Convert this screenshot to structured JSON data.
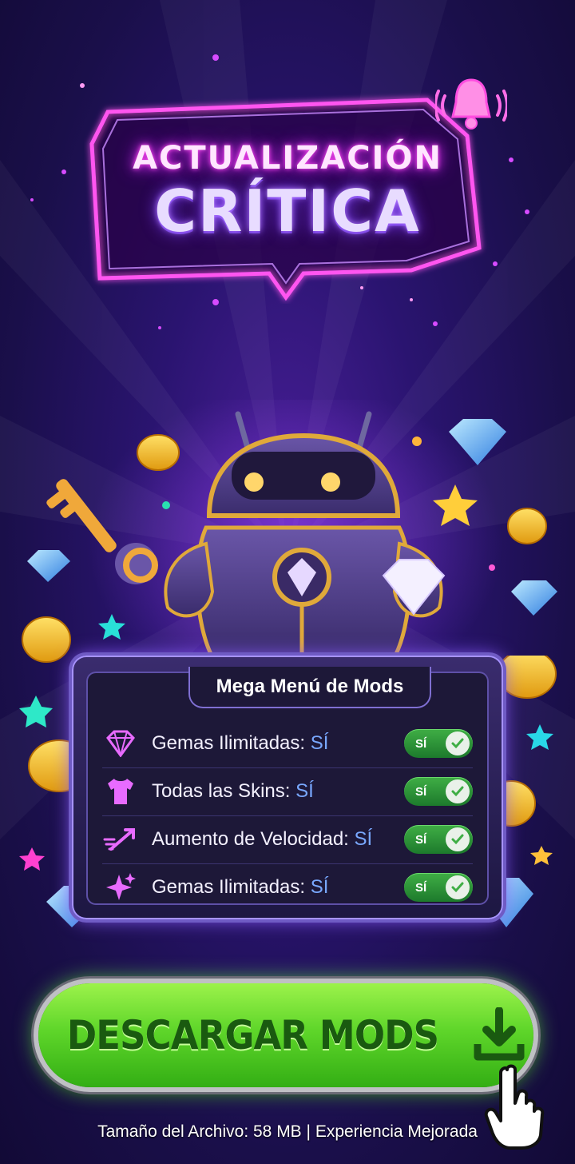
{
  "banner": {
    "line1": "ACTUALIZACIÓN",
    "line2": "CRÍTICA"
  },
  "panel": {
    "title": "Mega Menú de Mods",
    "rows": [
      {
        "label": "Gemas Ilimitadas: ",
        "value": "SÍ",
        "toggle": "SÍ",
        "icon": "gem-icon"
      },
      {
        "label": "Todas las Skins: ",
        "value": "SÍ",
        "toggle": "SÍ",
        "icon": "tshirt-icon"
      },
      {
        "label": "Aumento de Velocidad: ",
        "value": "SÍ",
        "toggle": "SÍ",
        "icon": "speed-arrow-icon"
      },
      {
        "label": "Gemas Ilimitadas: ",
        "value": "SÍ",
        "toggle": "SÍ",
        "icon": "sparkle-icon"
      }
    ]
  },
  "download": {
    "label": "DESCARGAR MODS"
  },
  "footer": {
    "text": "Tamaño del Archivo: 58 MB | Experiencia Mejorada"
  },
  "colors": {
    "accent_green": "#5fd62a",
    "neon_pink": "#ff4df0",
    "value_blue": "#79a8ff"
  }
}
